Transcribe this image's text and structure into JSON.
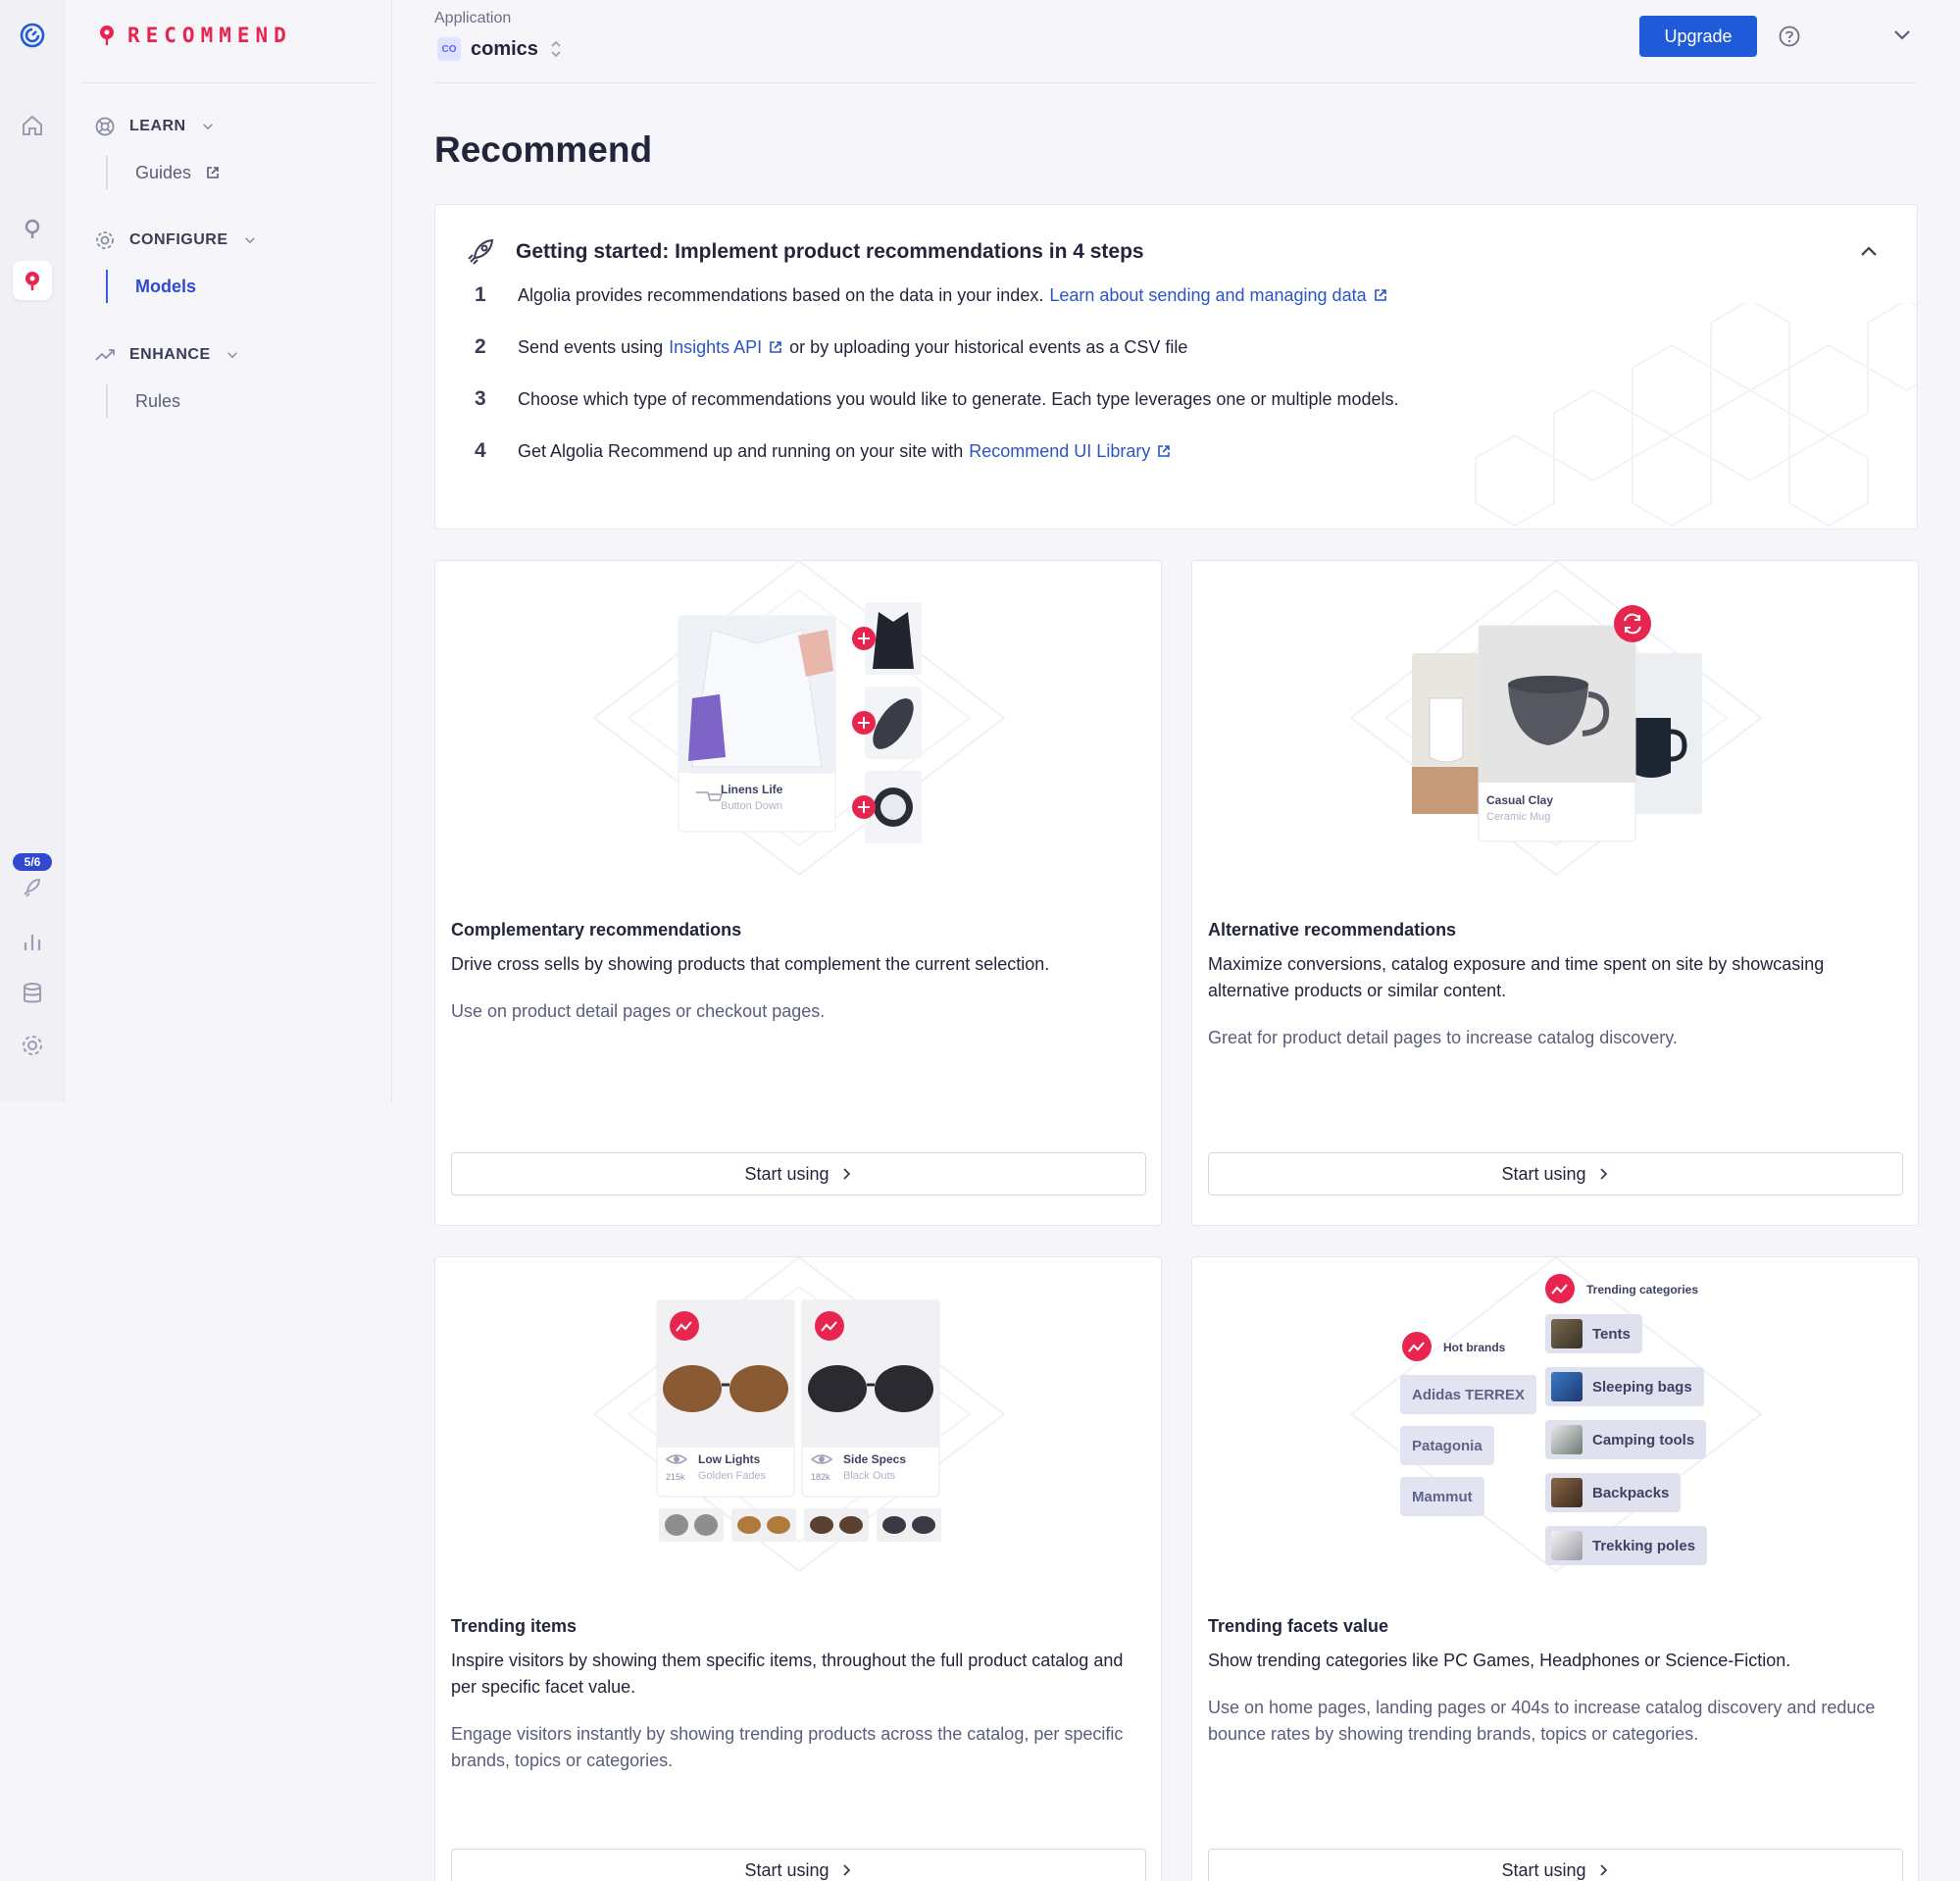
{
  "brand": {
    "name": "RECOMMEND",
    "accent": "#e8254f"
  },
  "rail": {
    "badge": "5/6"
  },
  "sidebar": {
    "sections": [
      {
        "label": "LEARN",
        "items": [
          {
            "label": "Guides"
          }
        ]
      },
      {
        "label": "CONFIGURE",
        "items": [
          {
            "label": "Models"
          }
        ]
      },
      {
        "label": "ENHANCE",
        "items": [
          {
            "label": "Rules"
          }
        ]
      }
    ]
  },
  "header": {
    "app_label": "Application",
    "app_chip": "CO",
    "app_name": "comics",
    "upgrade": "Upgrade"
  },
  "page": {
    "title": "Recommend"
  },
  "getting_started": {
    "title": "Getting started: Implement product recommendations in 4 steps",
    "steps": [
      {
        "num": "1",
        "text": "Algolia provides recommendations based on the data in your index.",
        "link": "Learn about sending and managing data",
        "after": ""
      },
      {
        "num": "2",
        "text": "Send events using",
        "link": "Insights API",
        "after": "or by uploading your historical events as a CSV file"
      },
      {
        "num": "3",
        "text": "Choose which type of recommendations you would like to generate. Each type leverages one or multiple models.",
        "link": "",
        "after": ""
      },
      {
        "num": "4",
        "text": "Get Algolia Recommend up and running on your site with",
        "link": "Recommend UI Library",
        "after": ""
      }
    ]
  },
  "cards": [
    {
      "title": "Complementary recommendations",
      "desc": "Drive cross sells by showing products that complement the current selection.",
      "hint": "Use on product detail pages or checkout pages.",
      "button": "Start using",
      "illus": {
        "name": "Linens Life",
        "sub": "Button Down"
      }
    },
    {
      "title": "Alternative recommendations",
      "desc": "Maximize conversions, catalog exposure and time spent on site by showcasing alternative products or similar content.",
      "hint": "Great for product detail pages to increase catalog discovery.",
      "button": "Start using",
      "illus": {
        "name": "Casual Clay",
        "sub": "Ceramic Mug"
      }
    },
    {
      "title": "Trending items",
      "desc": "Inspire visitors by showing them specific items, throughout the full product catalog and per specific facet value.",
      "hint": "Engage visitors instantly by showing trending products across the catalog, per specific brands, topics or categories.",
      "button": "Start using",
      "illus": {
        "items": [
          {
            "name": "Low Lights",
            "sub": "Golden Fades",
            "count": "215k"
          },
          {
            "name": "Side Specs",
            "sub": "Black Outs",
            "count": "182k"
          }
        ]
      }
    },
    {
      "title": "Trending facets value",
      "desc": "Show trending categories like PC Games, Headphones or Science-Fiction.",
      "hint": "Use on home pages, landing pages or 404s to increase catalog discovery and reduce bounce rates by showing trending brands, topics or categories.",
      "button": "Start using",
      "illus": {
        "brands_label": "Hot brands",
        "brands": [
          "Adidas TERREX",
          "Patagonia",
          "Mammut"
        ],
        "categories_label": "Trending categories",
        "categories": [
          "Tents",
          "Sleeping bags",
          "Camping tools",
          "Backpacks",
          "Trekking poles"
        ]
      }
    }
  ]
}
